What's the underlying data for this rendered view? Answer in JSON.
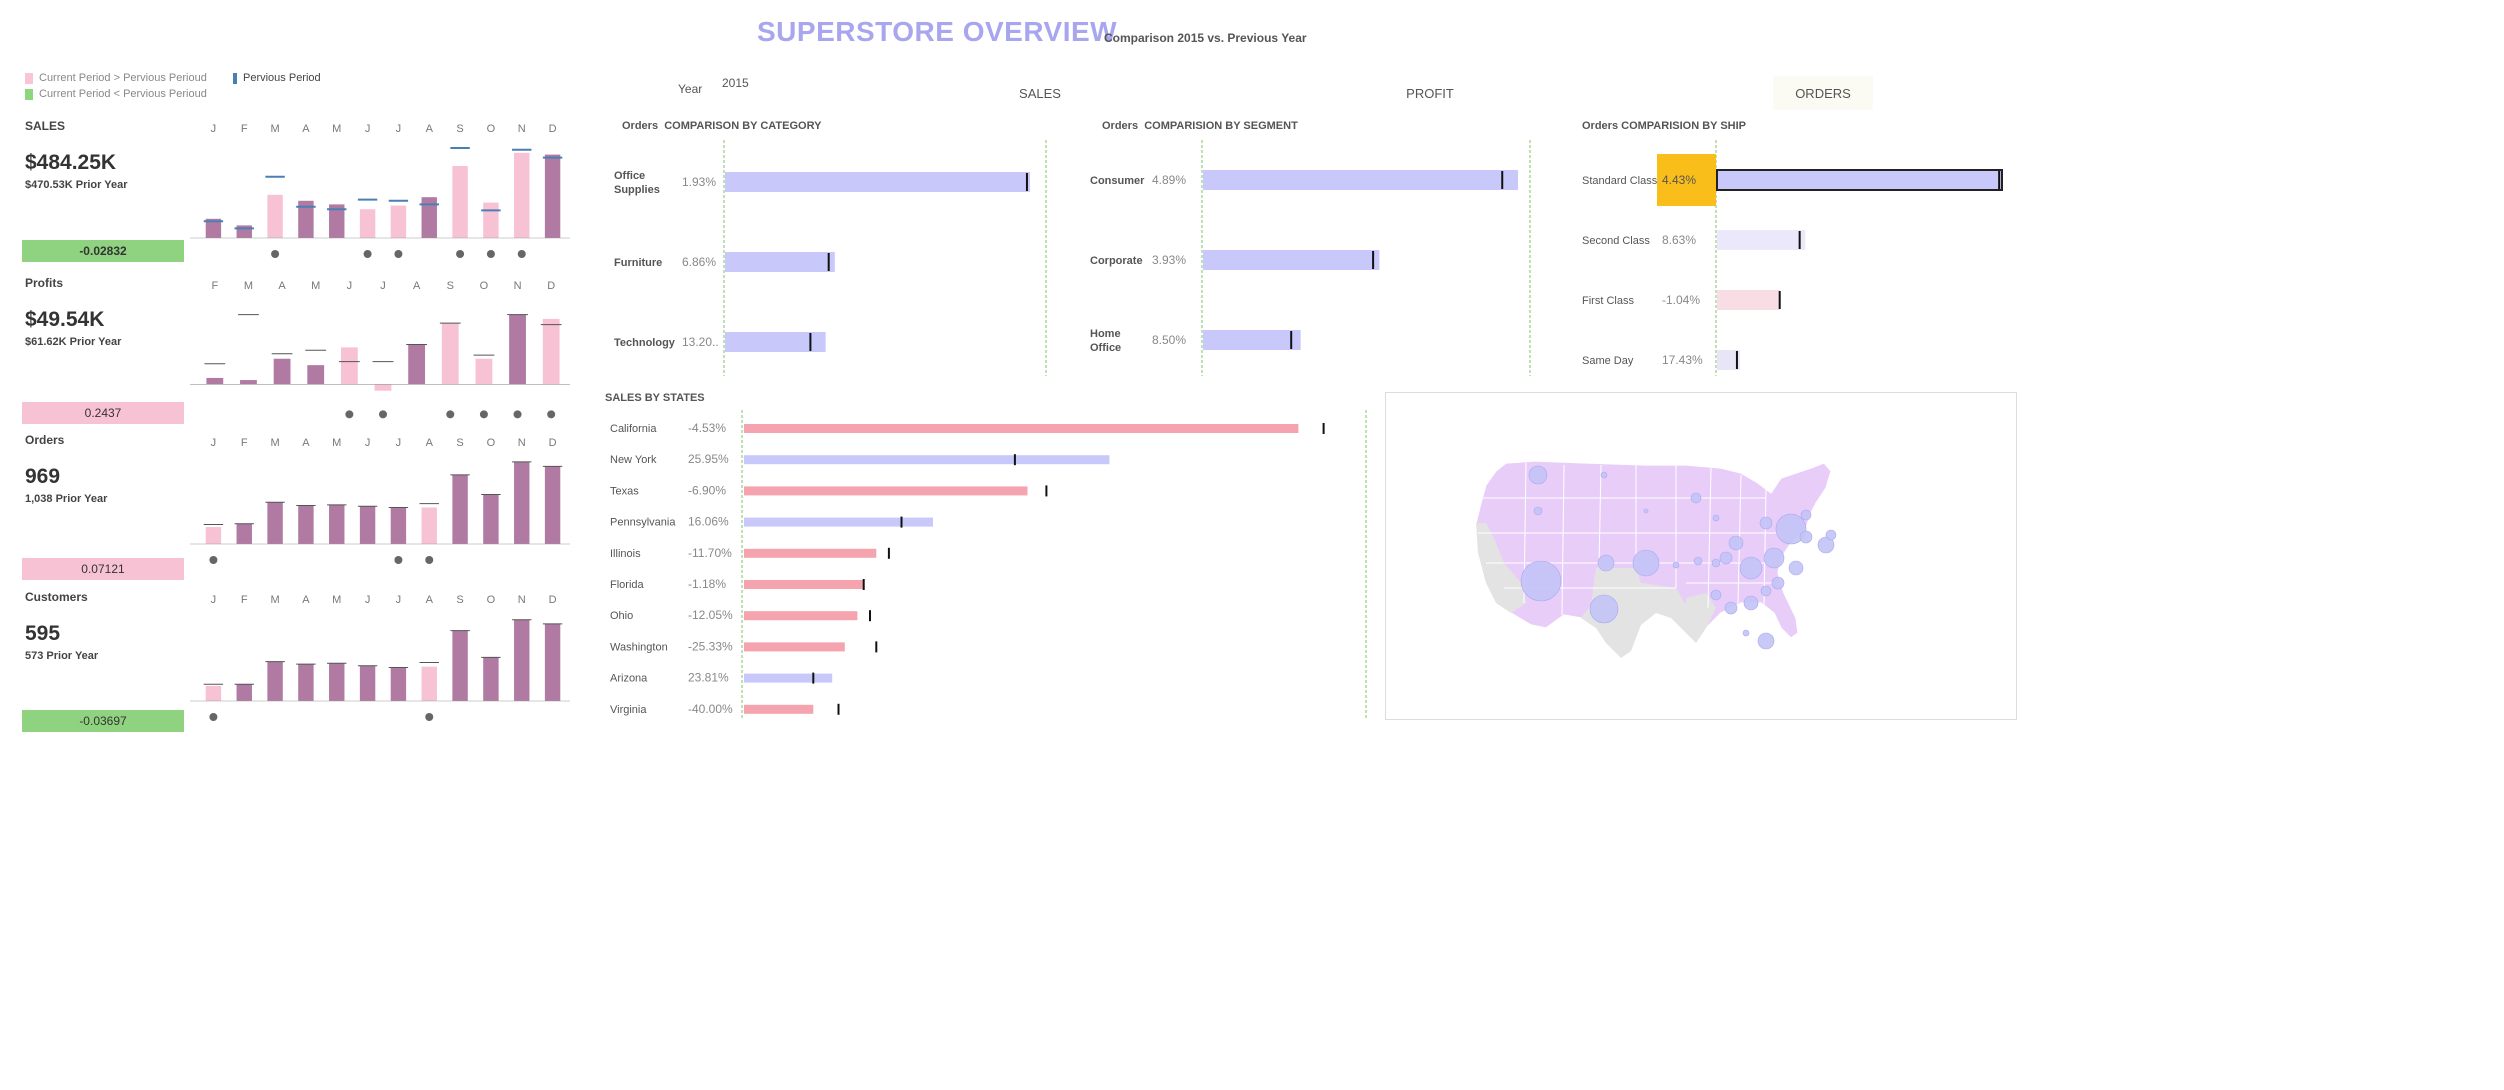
{
  "header": {
    "title": "SUPERSTORE OVERVIEW",
    "subtitle": "Comparison 2015 vs. Previous Year"
  },
  "legend": {
    "up_label": "Current Period > Pervious Perioud",
    "down_label": "Current Period < Pervious Perioud",
    "prev_label": "Pervious Period",
    "up_color": "#f9c4d6",
    "down_color": "#8cd67c",
    "prev_color": "#4a7fb5"
  },
  "filters": {
    "year_label": "Year",
    "year_value": "2015"
  },
  "tabs": [
    {
      "label": "SALES",
      "active": false
    },
    {
      "label": "PROFIT",
      "active": false
    },
    {
      "label": "ORDERS",
      "active": true
    }
  ],
  "colors": {
    "current_up": "#f8c2d5",
    "current_down": "#b07aa2",
    "prior_marker": "#4a7fb5",
    "bar_lavender": "#c9c8fb",
    "bar_pink": "#f5a3ae",
    "highlight": "#f9be19",
    "badge_green": "#8fd380",
    "badge_pink": "#f8c2d5",
    "map_fill": "#e9cdf9",
    "map_grey": "#e3e3e3",
    "bubble": "#c3c3f6",
    "dot": "#666666"
  },
  "kpis": [
    {
      "name": "SALES",
      "value": "$484.25K",
      "prior": "$470.53K Prior Year",
      "delta": "-0.02832",
      "badge": "green",
      "months": [
        "J",
        "F",
        "M",
        "A",
        "M",
        "J",
        "J",
        "A",
        "S",
        "O",
        "N",
        "D"
      ],
      "chart_data": {
        "type": "bar",
        "categories": [
          "J",
          "F",
          "M",
          "A",
          "M",
          "J",
          "J",
          "A",
          "S",
          "O",
          "N",
          "D"
        ],
        "series": [
          {
            "values": [
              3.2,
              2.1,
              7.2,
              6.2,
              5.6,
              4.8,
              5.4,
              6.8,
              12.0,
              5.9,
              14.2,
              13.9
            ]
          },
          {
            "values": [
              2.8,
              1.6,
              10.2,
              5.2,
              4.8,
              6.4,
              6.2,
              5.6,
              15.0,
              4.6,
              14.7,
              13.4
            ]
          }
        ],
        "highlight": [
          "down",
          "down",
          "up",
          "down",
          "down",
          "up",
          "up",
          "down",
          "up",
          "up",
          "up",
          "down"
        ],
        "dots": [
          false,
          false,
          true,
          false,
          false,
          true,
          true,
          false,
          true,
          true,
          true,
          false
        ],
        "ymax": 16
      }
    },
    {
      "name": "Profits",
      "value": "$49.54K",
      "prior": "$61.62K Prior Year",
      "delta": "0.2437",
      "badge": "pink",
      "months": [
        "F",
        "M",
        "A",
        "M",
        "J",
        "J",
        "A",
        "S",
        "O",
        "N",
        "D"
      ],
      "chart_data": {
        "type": "bar",
        "categories": [
          "F",
          "M",
          "A",
          "M",
          "J",
          "J",
          "A",
          "S",
          "O",
          "N",
          "D"
        ],
        "series": [
          {
            "values": [
              0.9,
              0.6,
              3.6,
              2.7,
              5.2,
              -0.9,
              5.6,
              8.6,
              3.6,
              9.8,
              9.2
            ]
          },
          {
            "values": [
              2.9,
              9.8,
              4.3,
              4.8,
              3.2,
              3.2,
              5.6,
              8.6,
              4.1,
              9.8,
              8.4
            ]
          }
        ],
        "highlight": [
          "down",
          "down",
          "down",
          "down",
          "up",
          "up",
          "down",
          "up",
          "up",
          "down",
          "up"
        ],
        "dots": [
          false,
          false,
          false,
          false,
          true,
          true,
          false,
          true,
          true,
          true,
          true
        ],
        "ymax": 12,
        "ymin": -1.5
      }
    },
    {
      "name": "Orders",
      "value": "969",
      "prior": "1,038 Prior Year",
      "delta": "0.07121",
      "badge": "pink",
      "months": [
        "J",
        "F",
        "M",
        "A",
        "M",
        "J",
        "J",
        "A",
        "S",
        "O",
        "N",
        "D"
      ],
      "chart_data": {
        "type": "bar",
        "categories": [
          "J",
          "F",
          "M",
          "A",
          "M",
          "J",
          "J",
          "A",
          "S",
          "O",
          "N",
          "D"
        ],
        "series": [
          {
            "values": [
              26,
              31,
              64,
              59,
              60,
              58,
              56,
              56,
              106,
              76,
              126,
              119
            ]
          },
          {
            "values": [
              30,
              31,
              64,
              59,
              60,
              58,
              56,
              62,
              106,
              76,
              126,
              119
            ]
          }
        ],
        "highlight": [
          "up",
          "down",
          "down",
          "down",
          "down",
          "down",
          "down",
          "up",
          "down",
          "down",
          "down",
          "down"
        ],
        "dots": [
          true,
          false,
          false,
          false,
          false,
          false,
          true,
          true,
          false,
          false,
          false,
          false
        ],
        "ymax": 135
      }
    },
    {
      "name": "Customers",
      "value": "595",
      "prior": "573 Prior Year",
      "delta": "-0.03697",
      "badge": "green",
      "months": [
        "J",
        "F",
        "M",
        "A",
        "M",
        "J",
        "J",
        "A",
        "S",
        "O",
        "N",
        "D"
      ],
      "chart_data": {
        "type": "bar",
        "categories": [
          "J",
          "F",
          "M",
          "A",
          "M",
          "J",
          "J",
          "A",
          "S",
          "O",
          "N",
          "D"
        ],
        "series": [
          {
            "values": [
              18,
              20,
              47,
              44,
              45,
              42,
              40,
              41,
              84,
              52,
              97,
              92
            ]
          },
          {
            "values": [
              20,
              20,
              47,
              44,
              45,
              42,
              40,
              46,
              84,
              52,
              97,
              92
            ]
          }
        ],
        "highlight": [
          "up",
          "down",
          "down",
          "down",
          "down",
          "down",
          "down",
          "up",
          "down",
          "down",
          "down",
          "down"
        ],
        "dots": [
          true,
          false,
          false,
          false,
          false,
          false,
          false,
          true,
          false,
          false,
          false,
          false
        ],
        "ymax": 105
      }
    }
  ],
  "category": {
    "title_prefix": "Orders",
    "title": "COMPARISON BY CATEGORY",
    "chart_data": {
      "type": "bar",
      "categories": [
        "Office Supplies",
        "Furniture",
        "Technology"
      ],
      "labels": [
        "Office\nSupplies",
        "Furniture",
        "Technology"
      ],
      "pct": [
        "1.93%",
        "6.86%",
        "13.20.."
      ],
      "values": [
        100,
        36,
        33
      ],
      "prior": [
        99,
        34,
        28
      ],
      "highlight": [
        false,
        false,
        false
      ]
    }
  },
  "segment": {
    "title_prefix": "Orders",
    "title": "COMPARISION BY SEGMENT",
    "chart_data": {
      "type": "bar",
      "categories": [
        "Consumer",
        "Corporate",
        "Home Office"
      ],
      "labels": [
        "Consumer",
        "Corporate",
        "Home\nOffice"
      ],
      "pct": [
        "4.89%",
        "3.93%",
        "8.50%"
      ],
      "values": [
        100,
        56,
        31
      ],
      "prior": [
        95,
        54,
        28
      ],
      "highlight": [
        false,
        false,
        false
      ]
    }
  },
  "ship": {
    "title": "Orders COMPARISION BY SHIP",
    "chart_data": {
      "type": "bar",
      "categories": [
        "Standard Class",
        "Second Class",
        "First Class",
        "Same Day"
      ],
      "pct": [
        "4.43%",
        "8.63%",
        "-1.04%",
        "17.43%"
      ],
      "values": [
        100,
        31,
        22,
        8
      ],
      "prior": [
        99,
        29,
        22,
        7
      ],
      "highlight": [
        true,
        false,
        false,
        false
      ]
    }
  },
  "states": {
    "title": "SALES BY STATES",
    "chart_data": {
      "type": "bar",
      "categories": [
        "California",
        "New York",
        "Texas",
        "Pennsylvania",
        "Illinois",
        "Florida",
        "Ohio",
        "Washington",
        "Arizona",
        "Virginia"
      ],
      "pct": [
        "-4.53%",
        "25.95%",
        "-6.90%",
        "16.06%",
        "-11.70%",
        "-1.18%",
        "-12.05%",
        "-25.33%",
        "23.81%",
        "-40.00%"
      ],
      "values": [
        88,
        58,
        45,
        30,
        21,
        19,
        18,
        16,
        14,
        11
      ],
      "prior": [
        92,
        43,
        48,
        25,
        23,
        19,
        20,
        21,
        11,
        15
      ]
    }
  },
  "map": {
    "country": "United States",
    "bubble_color": "#c3c3f6"
  }
}
